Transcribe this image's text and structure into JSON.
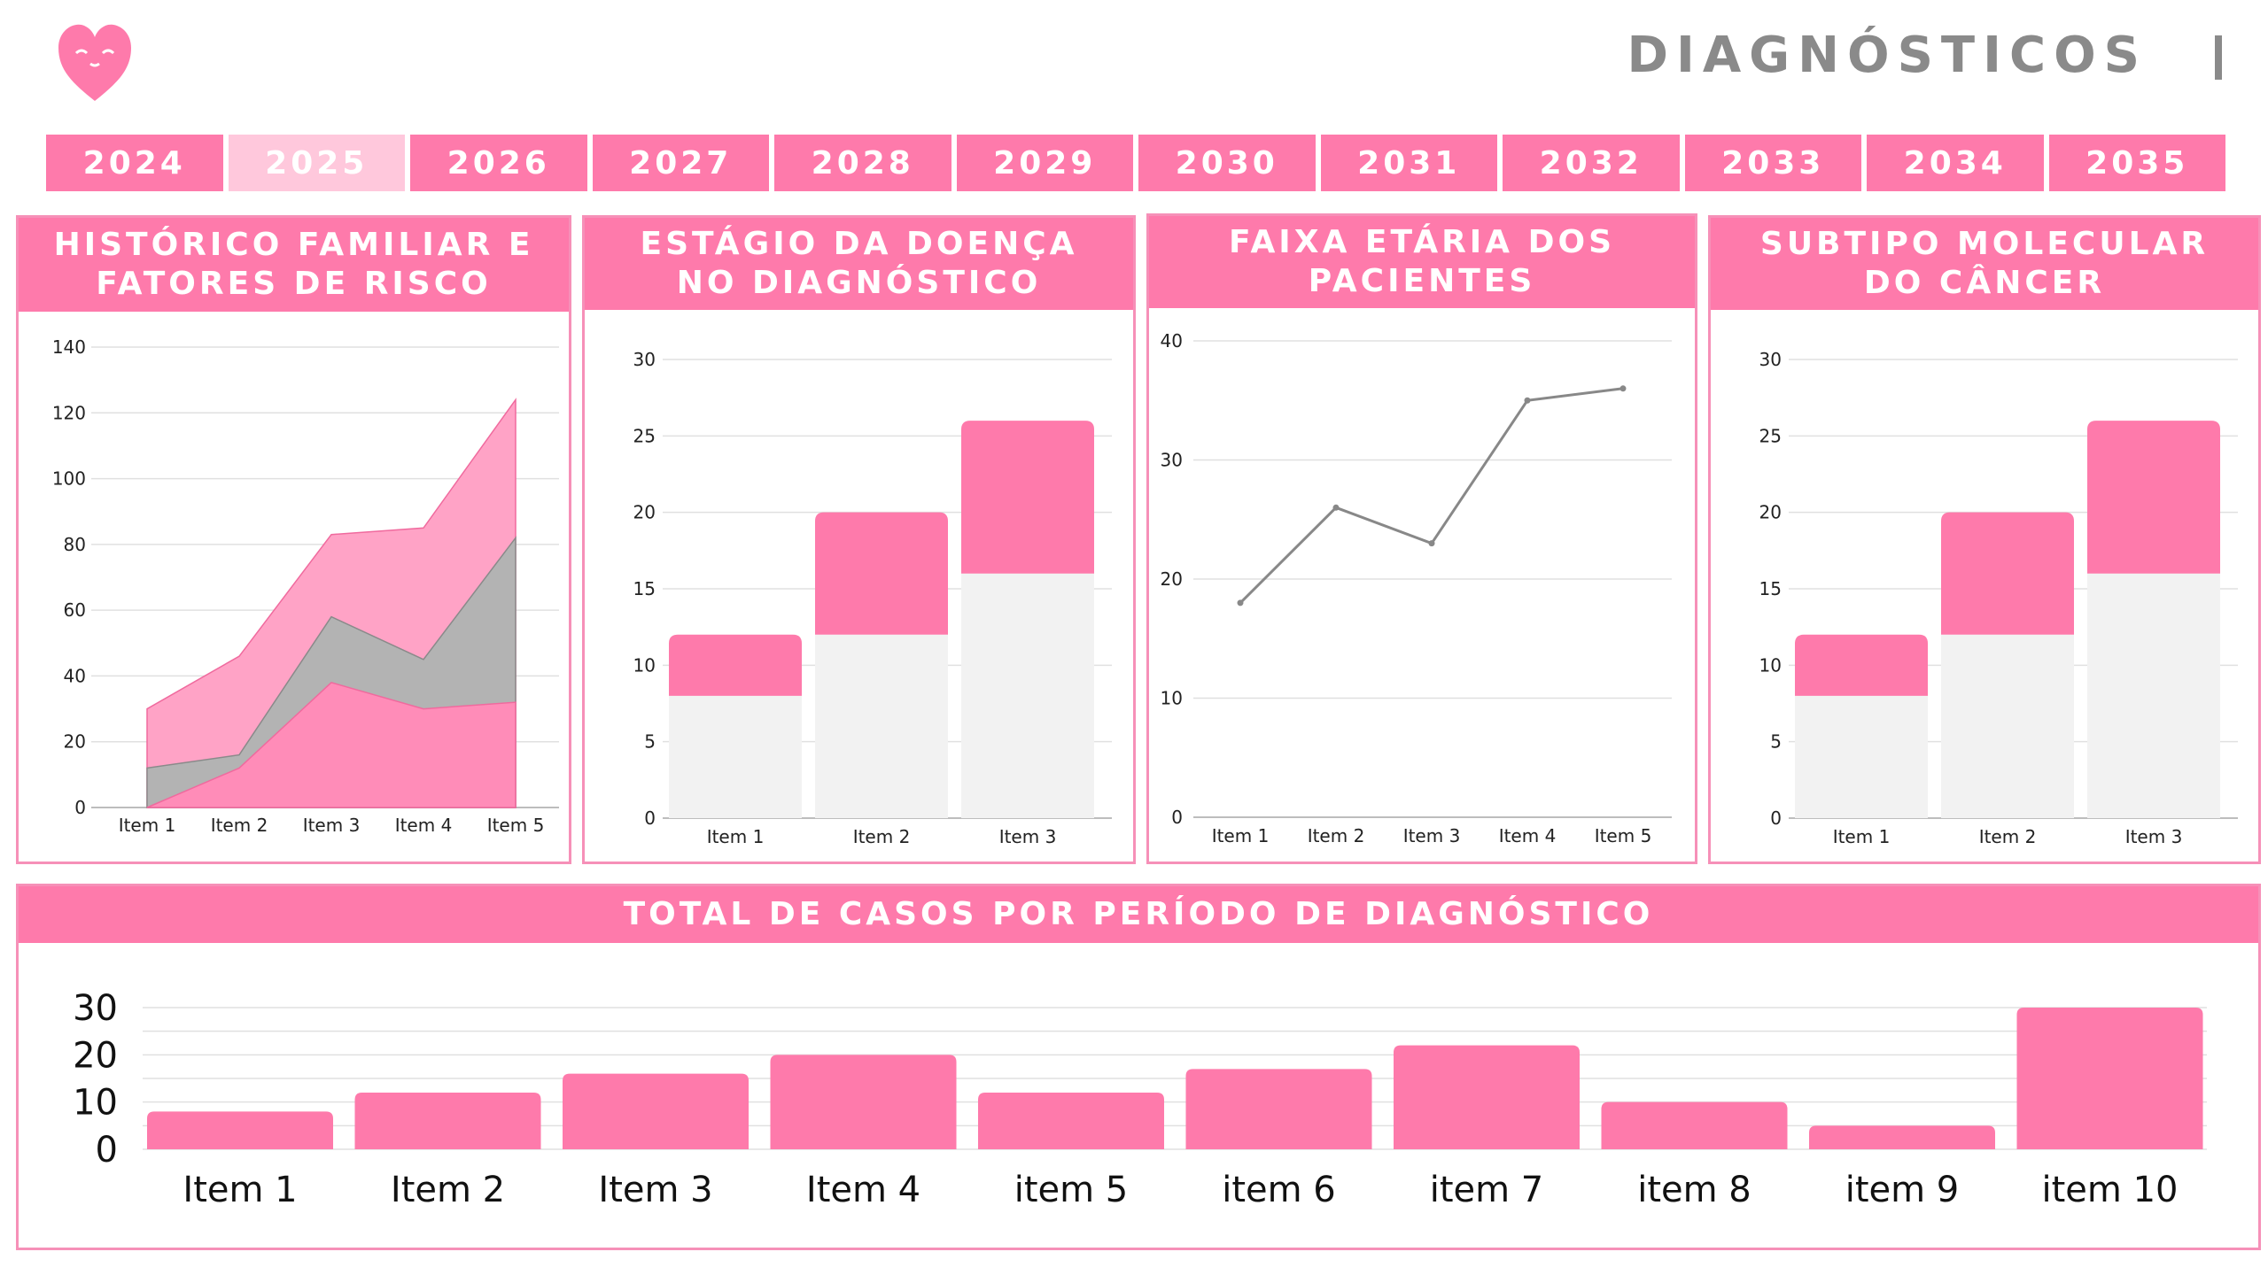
{
  "header": {
    "title": "DIAGNÓSTICOS",
    "brand_color": "#fe7aab"
  },
  "logo": {
    "icon": "heart-face-logo-icon"
  },
  "year_tabs": {
    "active": "2025",
    "items": [
      "2024",
      "2025",
      "2026",
      "2027",
      "2028",
      "2029",
      "2030",
      "2031",
      "2032",
      "2033",
      "2034",
      "2035"
    ]
  },
  "panels": {
    "family_history": {
      "title": "HISTÓRICO FAMILIAR E FATORES DE RISCO"
    },
    "disease_stage": {
      "title": "ESTÁGIO DA DOENÇA NO DIAGNÓSTICO"
    },
    "age_range": {
      "title": "FAIXA ETÁRIA DOS PACIENTES"
    },
    "molecular_subtype": {
      "title": "SUBTIPO MOLECULAR DO CÂNCER"
    },
    "total_cases": {
      "title": "TOTAL DE CASOS POR PERÍODO DE DIAGNÓSTICO"
    }
  },
  "chart_data": [
    {
      "id": "family_history",
      "type": "area",
      "stacked": false,
      "categories": [
        "Item 1",
        "Item 2",
        "Item 3",
        "Item 4",
        "Item 5"
      ],
      "series": [
        {
          "values": [
            30,
            46,
            83,
            85,
            124
          ],
          "color": "#ffa3c6"
        },
        {
          "values": [
            12,
            16,
            58,
            45,
            82
          ],
          "color": "#b3b3b3"
        },
        {
          "values": [
            0,
            12,
            38,
            30,
            32
          ],
          "color": "#ff8cb8"
        }
      ],
      "ylim": [
        0,
        140
      ],
      "yticks": [
        0,
        20,
        40,
        60,
        80,
        100,
        120,
        140
      ],
      "grid": true
    },
    {
      "id": "disease_stage",
      "type": "bar",
      "stacked": true,
      "categories": [
        "Item 1",
        "Item 2",
        "Item 3"
      ],
      "series": [
        {
          "values": [
            8,
            12,
            16
          ],
          "color": "#f2f2f2"
        },
        {
          "values": [
            4,
            8,
            10
          ],
          "color": "#fe7aab"
        }
      ],
      "ylim": [
        0,
        30
      ],
      "yticks": [
        0,
        5,
        10,
        15,
        20,
        25,
        30
      ],
      "grid": true
    },
    {
      "id": "age_range",
      "type": "line",
      "categories": [
        "Item 1",
        "Item 2",
        "Item 3",
        "Item 4",
        "Item 5"
      ],
      "series": [
        {
          "values": [
            18,
            26,
            23,
            35,
            36
          ],
          "color": "#888888"
        }
      ],
      "ylim": [
        0,
        40
      ],
      "yticks": [
        0,
        10,
        20,
        30,
        40
      ],
      "grid": true
    },
    {
      "id": "molecular_subtype",
      "type": "bar",
      "stacked": true,
      "categories": [
        "Item 1",
        "Item 2",
        "Item 3"
      ],
      "series": [
        {
          "values": [
            8,
            12,
            16
          ],
          "color": "#f2f2f2"
        },
        {
          "values": [
            4,
            8,
            10
          ],
          "color": "#fe7aab"
        }
      ],
      "ylim": [
        0,
        30
      ],
      "yticks": [
        0,
        5,
        10,
        15,
        20,
        25,
        30
      ],
      "grid": true
    },
    {
      "id": "total_cases",
      "type": "bar",
      "categories": [
        "Item 1",
        "Item 2",
        "Item 3",
        "Item 4",
        "item 5",
        "item 6",
        "item 7",
        "item 8",
        "item 9",
        "item 10"
      ],
      "series": [
        {
          "values": [
            8,
            12,
            16,
            20,
            12,
            17,
            22,
            10,
            5,
            30
          ],
          "color": "#fe7aab"
        }
      ],
      "ylim": [
        0,
        30
      ],
      "yticks": [
        0,
        10,
        20,
        30
      ],
      "grid": true
    }
  ]
}
